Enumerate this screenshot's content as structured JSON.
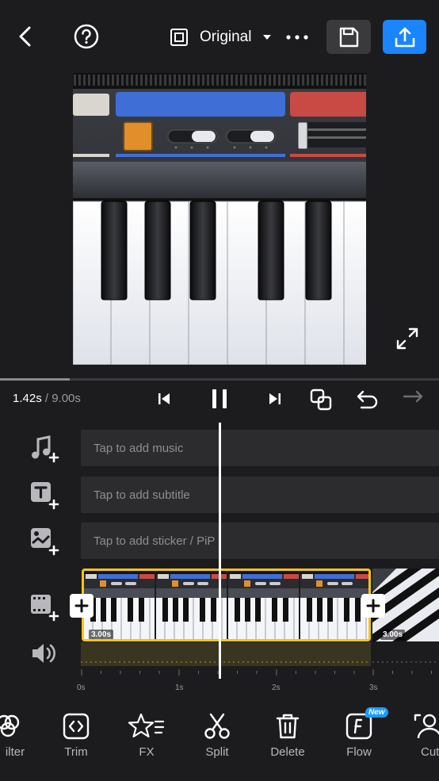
{
  "header": {
    "aspect_label": "Original",
    "icons": [
      "back-icon",
      "help-icon",
      "aspect-ratio-icon",
      "dropdown-icon",
      "more-icon",
      "save-icon",
      "export-icon"
    ]
  },
  "playback": {
    "current_time": "1.42s",
    "total_time": " / 9.00s",
    "progress": 0.158
  },
  "tracks": {
    "music_placeholder": "Tap to add music",
    "subtitle_placeholder": "Tap to add subtitle",
    "sticker_placeholder": "Tap to add sticker / PiP"
  },
  "clips": [
    {
      "duration_label": "3.00s"
    },
    {
      "duration_label": "3.00s"
    }
  ],
  "ruler": {
    "ticks": [
      "0s",
      "1s",
      "2s",
      "3s"
    ]
  },
  "toolbar": {
    "items": [
      {
        "label": "ilter",
        "icon": "filter-icon"
      },
      {
        "label": "Trim",
        "icon": "trim-icon"
      },
      {
        "label": "FX",
        "icon": "fx-icon"
      },
      {
        "label": "Split",
        "icon": "scissors-icon"
      },
      {
        "label": "Delete",
        "icon": "trash-icon"
      },
      {
        "label": "Flow",
        "icon": "flow-icon"
      },
      {
        "label": "Cutou",
        "icon": "cutout-icon"
      }
    ],
    "new_badge": "New"
  },
  "colors": {
    "accent": "#1a85ff",
    "clip_border": "#f5c518",
    "background": "#1c1c1e"
  }
}
